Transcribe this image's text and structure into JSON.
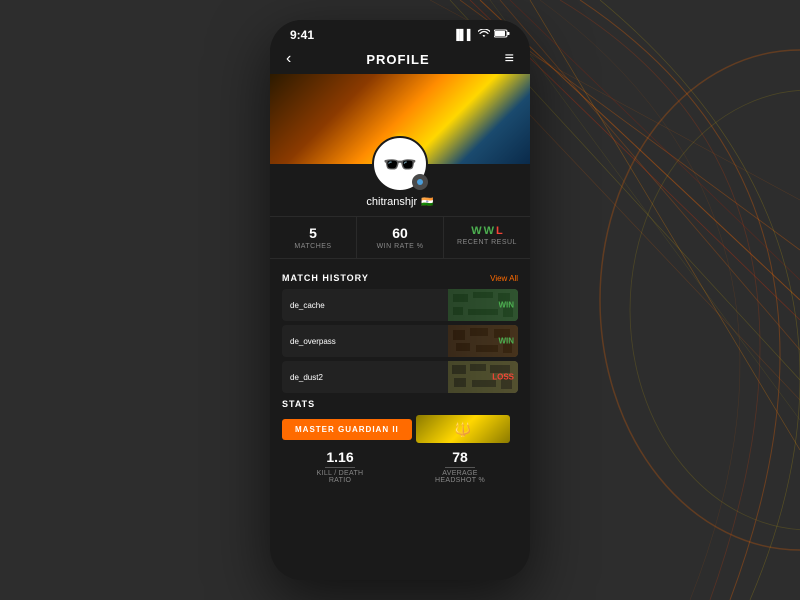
{
  "background": {
    "color": "#2d2d2d"
  },
  "statusBar": {
    "time": "9:41",
    "signal": "▐▌▌",
    "wifi": "wifi",
    "battery": "battery"
  },
  "navBar": {
    "back": "‹",
    "title": "PROFILE",
    "menu": "≡"
  },
  "avatar": {
    "username": "chitranshjr",
    "flag": "🇮🇳",
    "steamIcon": "⚙"
  },
  "statsRow": [
    {
      "value": "5",
      "label": "MATCHES"
    },
    {
      "value": "60",
      "label": "WIN RATE %"
    },
    {
      "recentLabel": "RECENT RESULTS",
      "results": [
        "W",
        "W",
        "L"
      ]
    }
  ],
  "matchHistory": {
    "sectionTitle": "MATCH HISTORY",
    "viewAll": "View All",
    "matches": [
      {
        "name": "de_cache",
        "result": "WIN",
        "resultType": "win",
        "thumbClass": "match-thumb-cache"
      },
      {
        "name": "de_overpass",
        "result": "WIN",
        "resultType": "win",
        "thumbClass": "match-thumb-overpass"
      },
      {
        "name": "de_dust2",
        "result": "LOSS",
        "resultType": "loss",
        "thumbClass": "match-thumb-dust2"
      }
    ]
  },
  "statsSection": {
    "sectionTitle": "STATS",
    "rankButton": "MASTER GUARDIAN II",
    "detailedStats": [
      {
        "value": "1.16",
        "label": "KILL / DEATH\nRATIO"
      },
      {
        "value": "78",
        "label": "AVERAGE\nHEADSHOT %"
      }
    ]
  },
  "colors": {
    "accent": "#FF6B00",
    "win": "#4CAF50",
    "loss": "#f44336",
    "bg": "#1a1a1a",
    "cardBg": "#222222"
  }
}
